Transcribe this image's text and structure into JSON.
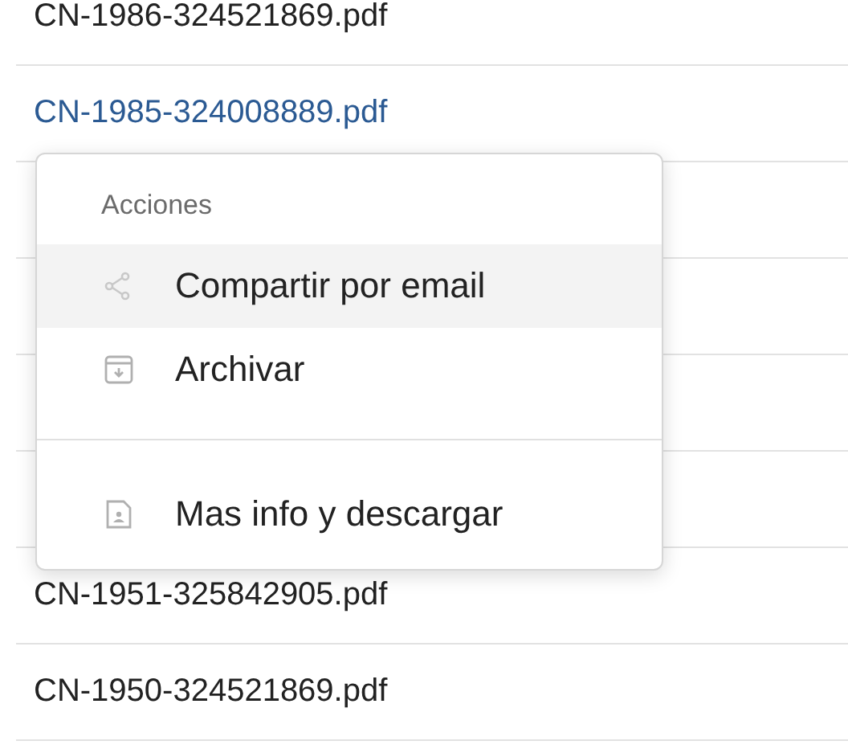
{
  "rows": [
    {
      "name": "CN-1986-324521869.pdf",
      "highlighted": false
    },
    {
      "name": "CN-1985-324008889.pdf",
      "highlighted": true
    },
    {
      "name": "CN-1951-325842905.pdf",
      "highlighted": false
    },
    {
      "name": "CN-1950-324521869.pdf",
      "highlighted": false
    }
  ],
  "menu": {
    "header": "Acciones",
    "groups": [
      [
        {
          "label": "Compartir por email",
          "kind": "share",
          "selected": true
        },
        {
          "label": "Archivar",
          "kind": "archive",
          "selected": false
        }
      ],
      [
        {
          "label": "Mas info y descargar",
          "kind": "document",
          "selected": false
        }
      ]
    ]
  }
}
